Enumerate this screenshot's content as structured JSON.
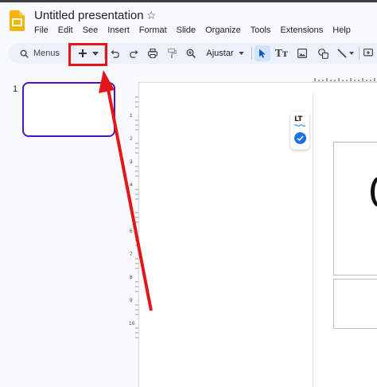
{
  "app": {
    "title": "Untitled presentation",
    "logo_icon": "slides-logo-icon",
    "star_icon": "star-outline-icon"
  },
  "menubar": {
    "items": [
      "File",
      "Edit",
      "See",
      "Insert",
      "Format",
      "Slide",
      "Organize",
      "Tools",
      "Extensions",
      "Help"
    ]
  },
  "toolbar": {
    "search_label": "Menus",
    "zoom_label": "Ajustar",
    "text_format_glyph": "Tт",
    "icons": [
      "search-icon",
      "new-slide-plus-icon",
      "dropdown-caret-icon",
      "undo-icon",
      "redo-icon",
      "print-icon",
      "paint-format-icon",
      "zoom-icon",
      "select-cursor-icon",
      "text-box-icon",
      "image-icon",
      "shape-icon",
      "line-icon",
      "comment-icon"
    ]
  },
  "filmstrip": {
    "slides": [
      {
        "number": "1"
      }
    ]
  },
  "rulers": {
    "vertical_labels": [
      "1",
      "2",
      "3",
      "4",
      "5",
      "6",
      "7",
      "8",
      "9",
      "10"
    ]
  },
  "language_chip": {
    "label": "LT",
    "icon": "check-circle-icon"
  },
  "annotation": {
    "color": "#e5161a",
    "target": "new-slide-plus-button"
  },
  "colors": {
    "toolbar_bg": "#edf2fa",
    "selected_thumb_border": "#4f12c2",
    "accent_blue": "#1a73e8",
    "slides_yellow": "#f4b400"
  }
}
